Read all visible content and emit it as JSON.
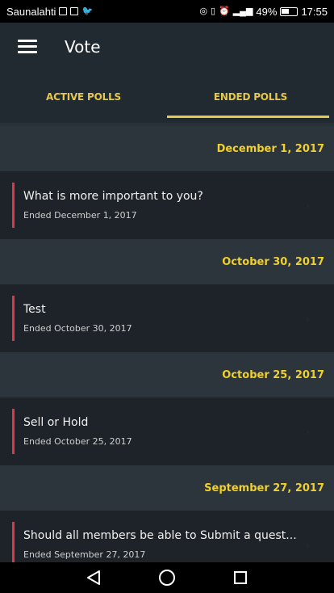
{
  "status": {
    "carrier": "Saunalahti",
    "battery": "49%",
    "time": "17:55"
  },
  "appbar": {
    "title": "Vote"
  },
  "tabs": [
    {
      "label": "ACTIVE POLLS",
      "active": false
    },
    {
      "label": "ENDED POLLS",
      "active": true
    }
  ],
  "groups": [
    {
      "date": "December 1, 2017",
      "poll": {
        "title": "What is more important to you?",
        "subtitle": "Ended December 1, 2017"
      }
    },
    {
      "date": "October 30, 2017",
      "poll": {
        "title": "Test",
        "subtitle": "Ended October 30, 2017"
      }
    },
    {
      "date": "October 25, 2017",
      "poll": {
        "title": "Sell or Hold",
        "subtitle": "Ended October 25, 2017"
      }
    },
    {
      "date": "September 27, 2017",
      "poll": {
        "title": "Should all members be able to Submit a quest...",
        "subtitle": "Ended September 27, 2017"
      }
    }
  ],
  "colors": {
    "accent": "#e6c84a",
    "indicator": "#d9394a",
    "appbar": "#222a31",
    "header_bg": "#2c343c",
    "row_bg": "#1e2329"
  },
  "icons": {
    "menu": "hamburger-menu-icon",
    "back": "back-triangle-icon",
    "home": "home-circle-icon",
    "recents": "recents-square-icon"
  }
}
